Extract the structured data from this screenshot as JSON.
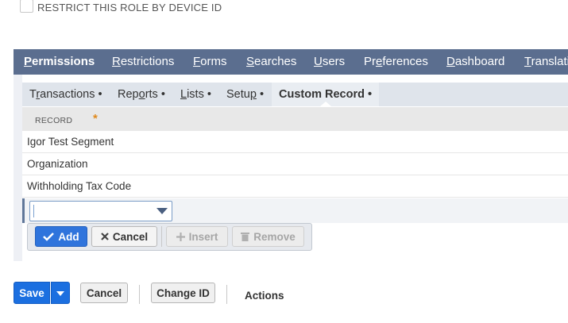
{
  "restrict": {
    "label": "RESTRICT THIS ROLE BY DEVICE ID",
    "checked": false
  },
  "main_tabs": [
    {
      "ul": "P",
      "rest": "ermissions",
      "active": true
    },
    {
      "ul": "R",
      "rest": "estrictions",
      "active": false
    },
    {
      "ul": "F",
      "rest": "orms",
      "active": false
    },
    {
      "ul": "S",
      "rest": "earches",
      "active": false
    },
    {
      "ul": "U",
      "rest": "sers",
      "active": false
    },
    {
      "pre": "Pr",
      "ul": "e",
      "rest": "ferences",
      "active": false
    },
    {
      "ul": "D",
      "rest": "ashboard",
      "active": false
    },
    {
      "ul": "T",
      "rest": "ranslati",
      "active": false
    }
  ],
  "sub_tabs": [
    {
      "pre": "T",
      "ul": "r",
      "rest": "ansactions •"
    },
    {
      "pre": "Rep",
      "ul": "o",
      "rest": "rts •"
    },
    {
      "ul": "L",
      "rest": "ists •"
    },
    {
      "pre": "Setu",
      "ul": "p",
      "rest": " •"
    },
    {
      "pre": "Custom Record •",
      "ul": "",
      "rest": ""
    }
  ],
  "table": {
    "header": "RECORD",
    "required_marker": "*",
    "rows": [
      "Igor Test Segment",
      "Organization",
      "Withholding Tax Code"
    ]
  },
  "line_buttons": {
    "add": "Add",
    "cancel": "Cancel",
    "insert": "Insert",
    "remove": "Remove"
  },
  "footer": {
    "save": "Save",
    "cancel": "Cancel",
    "change_id": "Change ID",
    "actions": "Actions"
  },
  "colors": {
    "tab_bar": "#5b6e8f",
    "primary_button": "#1b6fe0",
    "required": "#e08a1e"
  }
}
